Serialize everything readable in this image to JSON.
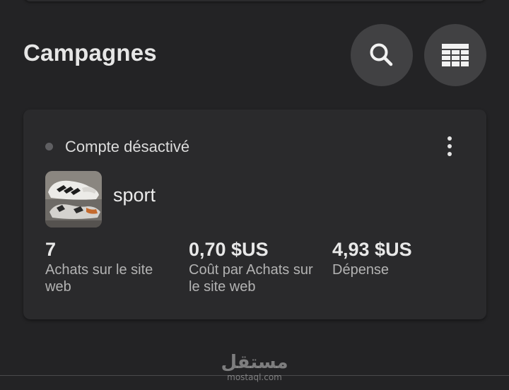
{
  "header": {
    "title": "Campagnes",
    "search_icon": "search-icon",
    "table_icon": "table-icon"
  },
  "campaign": {
    "status": "Compte désactivé",
    "status_dot_color": "#5f5f62",
    "name": "sport",
    "thumbnail": "sneakers-image",
    "metrics": [
      {
        "value": "7",
        "label": "Achats sur le site web"
      },
      {
        "value": "0,70 $US",
        "label": "Coût par Achats sur le site web"
      },
      {
        "value": "4,93 $US",
        "label": "Dépense"
      }
    ]
  },
  "watermark": {
    "main": "مستقل",
    "sub": "mostaql.com"
  },
  "colors": {
    "background": "#232325",
    "card": "#2a2a2c",
    "button": "#414143"
  }
}
